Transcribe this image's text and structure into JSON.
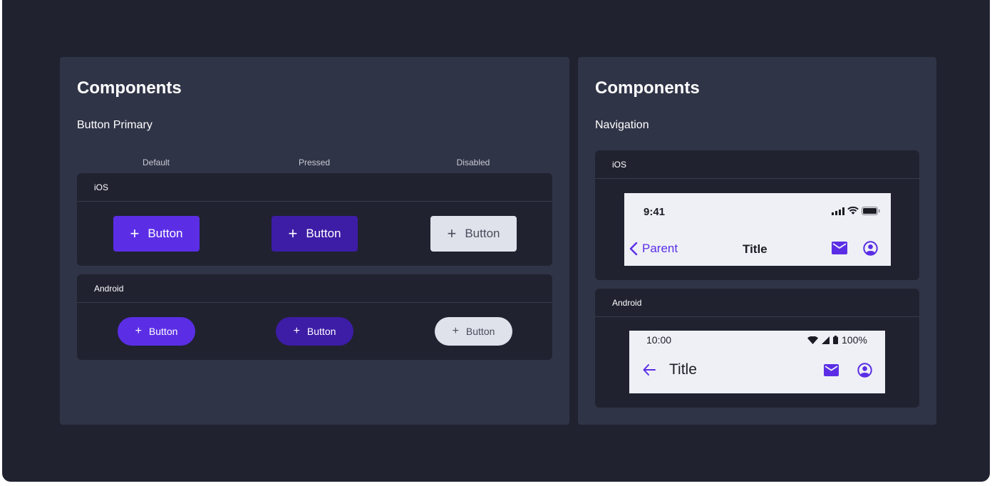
{
  "left_card": {
    "title": "Components",
    "section": "Button Primary",
    "columns": [
      "Default",
      "Pressed",
      "Disabled"
    ],
    "ios_panel": {
      "label": "iOS",
      "buttons": [
        {
          "state": "default",
          "label": "Button"
        },
        {
          "state": "pressed",
          "label": "Button"
        },
        {
          "state": "disabled",
          "label": "Button"
        }
      ]
    },
    "android_panel": {
      "label": "Android",
      "buttons": [
        {
          "state": "default",
          "label": "Button"
        },
        {
          "state": "pressed",
          "label": "Button"
        },
        {
          "state": "disabled",
          "label": "Button"
        }
      ]
    }
  },
  "right_card": {
    "title": "Components",
    "section": "Navigation",
    "ios_panel": {
      "label": "iOS",
      "status_time": "9:41",
      "back_label": "Parent",
      "nav_title": "Title",
      "icons": [
        "signal-icon",
        "wifi-icon",
        "battery-icon",
        "mail-icon",
        "account-icon"
      ]
    },
    "android_panel": {
      "label": "Android",
      "status_time": "10:00",
      "battery_text": "100%",
      "nav_title": "Title",
      "icons": [
        "wifi-icon",
        "signal-icon",
        "battery-icon",
        "back-arrow-icon",
        "mail-icon",
        "account-icon"
      ]
    }
  },
  "colors": {
    "primary": "#5b2ee6",
    "pressed": "#3d1ca6",
    "disabled": "#dfe2ea",
    "background": "#202230",
    "card": "#303447"
  }
}
